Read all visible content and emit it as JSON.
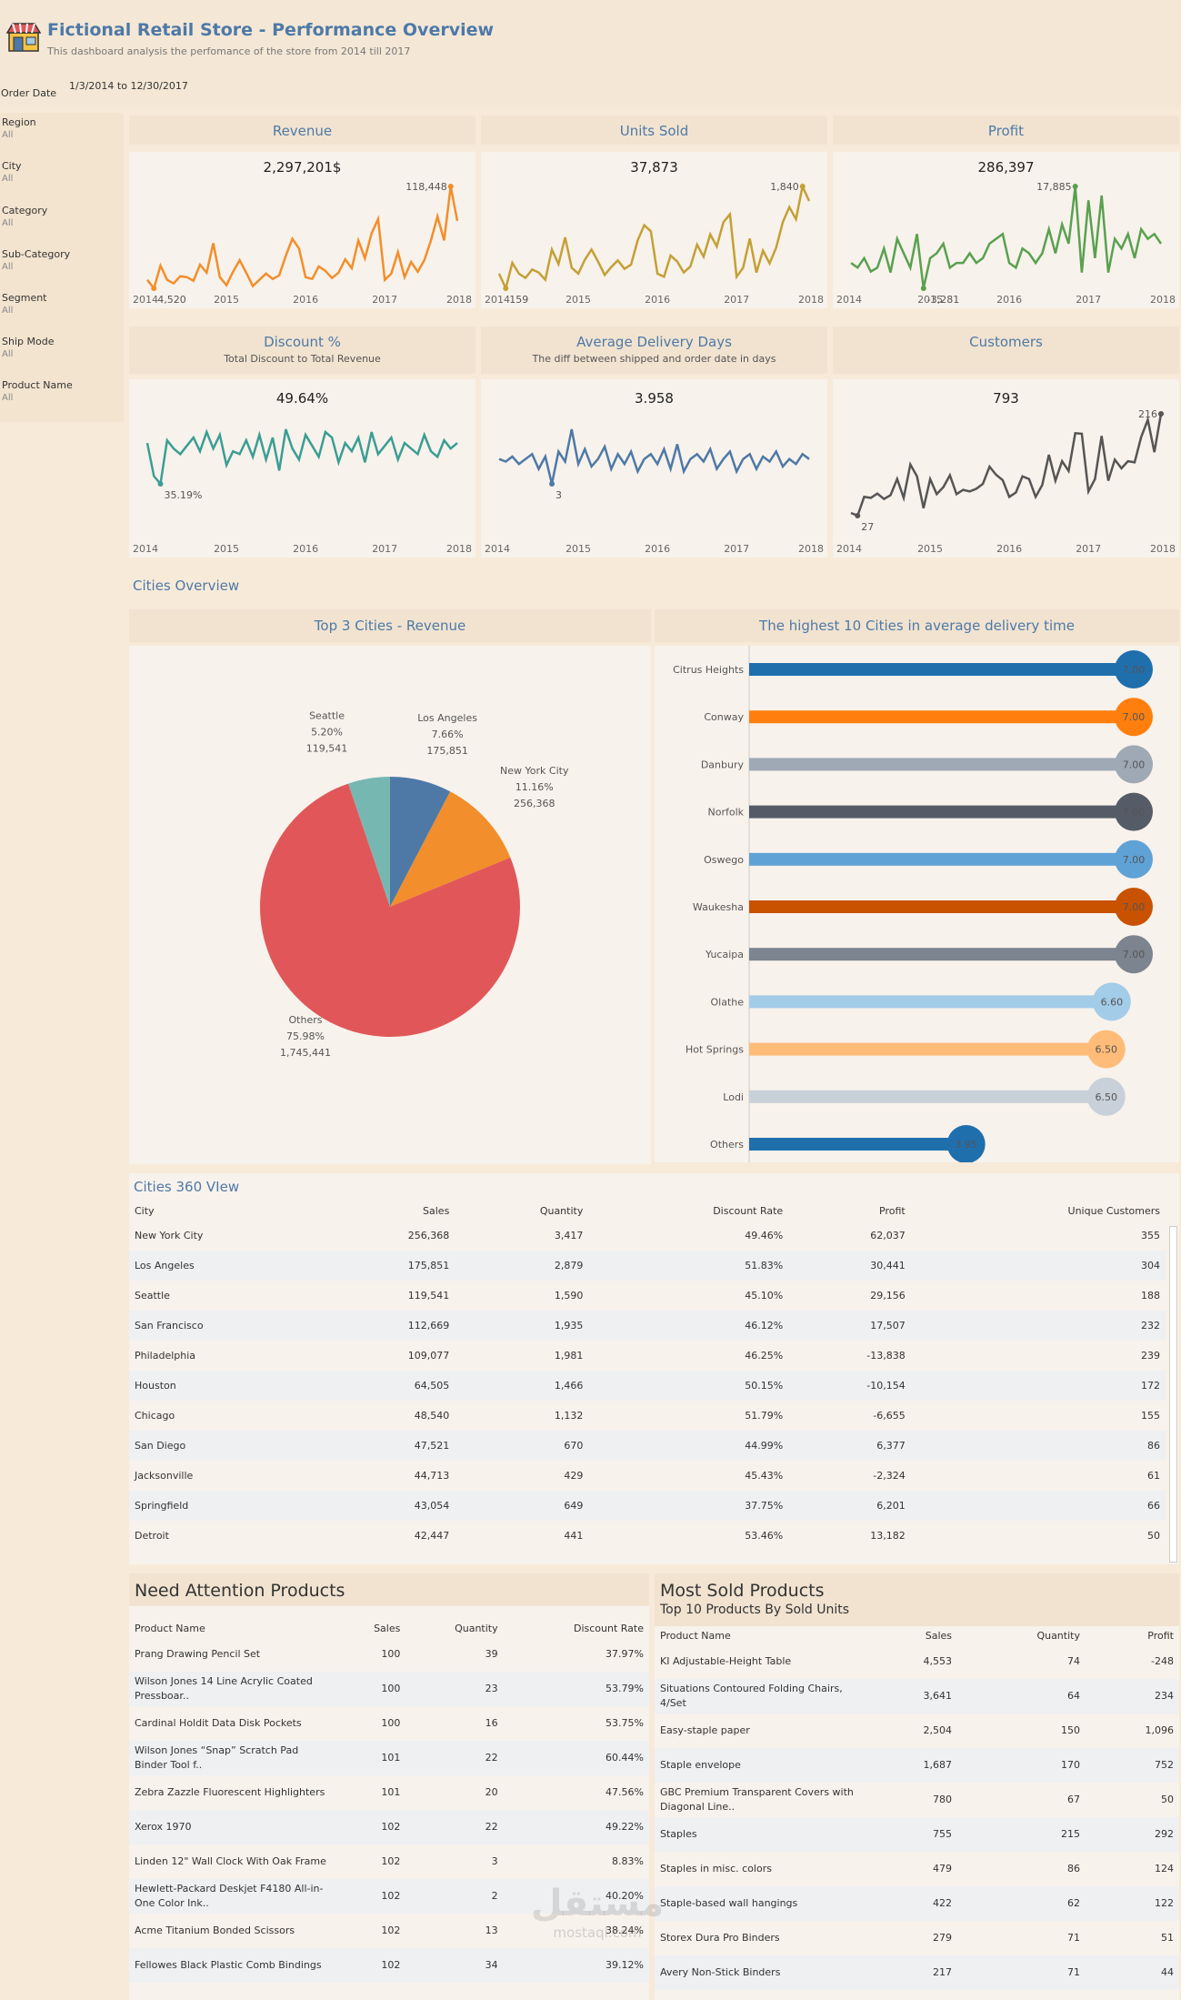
{
  "header": {
    "title": "Fictional Retail Store - Performance Overview",
    "subtitle": "This dashboard analysis the perfomance of the store from 2014 till 2017",
    "order_date_label": "Order Date",
    "order_date_value": "1/3/2014 to 12/30/2017"
  },
  "filters": [
    {
      "label": "Region",
      "value": "All"
    },
    {
      "label": "City",
      "value": "All"
    },
    {
      "label": "Category",
      "value": "All"
    },
    {
      "label": "Sub-Category",
      "value": "All"
    },
    {
      "label": "Segment",
      "value": "All"
    },
    {
      "label": "Ship Mode",
      "value": "All"
    },
    {
      "label": "Product Name",
      "value": "All"
    }
  ],
  "kpis": {
    "revenue": {
      "title": "Revenue",
      "value": "2,297,201$",
      "min_label": "4,520",
      "max_label": "118,448"
    },
    "units": {
      "title": "Units Sold",
      "value": "37,873",
      "min_label": "159",
      "max_label": "1,840"
    },
    "profit": {
      "title": "Profit",
      "value": "286,397",
      "min_label": "-3,281",
      "max_label": "17,885"
    },
    "discount": {
      "title": "Discount %",
      "subtitle": "Total Discount to Total Revenue",
      "value": "49.64%",
      "min_label": "35.19%"
    },
    "delivery": {
      "title": "Average Delivery Days",
      "subtitle": "The diff between shipped and order date in days",
      "value": "3.958",
      "min_label": "3"
    },
    "customers": {
      "title": "Customers",
      "value": "793",
      "min_label": "27",
      "max_label": "216"
    }
  },
  "years": [
    "2014",
    "2015",
    "2016",
    "2017",
    "2018"
  ],
  "colors": {
    "revenue": "#f28e2b",
    "units": "#c4a035",
    "profit": "#59a14f",
    "discount": "#3a9e94",
    "delivery": "#4e79a7",
    "customers": "#555555"
  },
  "chart_data": [
    {
      "type": "line",
      "title": "Revenue",
      "x_range": [
        "2014-01",
        "2017-12"
      ],
      "series": [
        {
          "values": [
            14000,
            4520,
            30000,
            14000,
            10000,
            18000,
            17000,
            13000,
            31000,
            22000,
            55000,
            17000,
            8000,
            23000,
            36000,
            22000,
            7000,
            14000,
            21000,
            15000,
            19000,
            41000,
            60000,
            49000,
            17000,
            15000,
            29000,
            24000,
            16000,
            22000,
            37000,
            27000,
            58000,
            38000,
            66000,
            82000,
            14000,
            21000,
            45000,
            17000,
            34000,
            23000,
            36000,
            58000,
            85000,
            58000,
            118448,
            80000
          ]
        }
      ]
    },
    {
      "type": "line",
      "title": "Units Sold",
      "x_range": [
        "2014-01",
        "2017-12"
      ],
      "series": [
        {
          "values": [
            400,
            159,
            580,
            400,
            330,
            470,
            420,
            300,
            800,
            560,
            1000,
            500,
            400,
            630,
            800,
            600,
            380,
            510,
            620,
            480,
            550,
            950,
            1200,
            1100,
            400,
            350,
            700,
            600,
            420,
            520,
            880,
            680,
            1050,
            850,
            1250,
            1380,
            350,
            500,
            980,
            420,
            780,
            570,
            830,
            1250,
            1500,
            1300,
            1840,
            1600
          ]
        }
      ]
    },
    {
      "type": "line",
      "title": "Profit",
      "x_range": [
        "2014-01",
        "2017-12"
      ],
      "series": [
        {
          "values": [
            2000,
            1000,
            3000,
            200,
            1000,
            5000,
            0,
            7000,
            4000,
            1000,
            8000,
            -3281,
            3000,
            4000,
            6000,
            1000,
            2000,
            2000,
            4000,
            2000,
            3000,
            6000,
            7000,
            8000,
            2000,
            1000,
            5000,
            4000,
            2000,
            4000,
            9000,
            4000,
            10000,
            6000,
            17885,
            0,
            15000,
            3000,
            16000,
            0,
            7000,
            5000,
            8000,
            3000,
            9000,
            7000,
            8000,
            6000
          ]
        }
      ]
    },
    {
      "type": "line",
      "title": "Discount %",
      "x_range": [
        "2014-01",
        "2017-12"
      ],
      "series": [
        {
          "values": [
            50,
            38,
            35.19,
            51,
            48,
            46,
            49,
            52,
            47,
            54,
            48,
            53,
            42,
            47,
            46,
            51,
            45,
            53,
            44,
            52,
            40,
            55,
            48,
            44,
            53,
            49,
            45,
            54,
            52,
            43,
            50,
            47,
            52,
            43,
            54,
            46,
            49,
            52,
            44,
            50,
            48,
            46,
            53,
            47,
            45,
            51,
            48,
            50
          ]
        }
      ]
    },
    {
      "type": "line",
      "title": "Average Delivery Days",
      "x_range": [
        "2014-01",
        "2017-12"
      ],
      "series": [
        {
          "values": [
            4.0,
            3.9,
            4.1,
            3.8,
            4.0,
            4.2,
            3.6,
            4.1,
            3.0,
            4.3,
            3.9,
            5.2,
            3.8,
            4.4,
            3.7,
            4.0,
            4.5,
            3.6,
            4.2,
            3.8,
            4.3,
            3.5,
            4.0,
            4.2,
            3.8,
            4.4,
            3.6,
            4.6,
            3.5,
            4.0,
            4.2,
            3.9,
            4.4,
            3.6,
            4.0,
            4.3,
            3.5,
            4.0,
            4.2,
            3.6,
            4.1,
            3.9,
            4.3,
            3.7,
            4.0,
            3.8,
            4.2,
            4.0
          ]
        }
      ]
    },
    {
      "type": "line",
      "title": "Customers",
      "x_range": [
        "2014-01",
        "2017-12"
      ],
      "series": [
        {
          "values": [
            32,
            27,
            62,
            60,
            68,
            58,
            65,
            95,
            60,
            122,
            100,
            41,
            95,
            67,
            80,
            102,
            67,
            75,
            72,
            77,
            86,
            118,
            103,
            93,
            62,
            70,
            100,
            95,
            62,
            84,
            140,
            92,
            128,
            110,
            180,
            179,
            72,
            95,
            175,
            92,
            131,
            115,
            128,
            126,
            173,
            205,
            145,
            216
          ]
        }
      ]
    },
    {
      "type": "pie",
      "title": "Top 3 Cities - Revenue",
      "slices": [
        {
          "label": "Los Angeles",
          "pct": "7.66%",
          "value": 175851,
          "value_label": "175,851",
          "color": "#4e79a7"
        },
        {
          "label": "New York City",
          "pct": "11.16%",
          "value": 256368,
          "value_label": "256,368",
          "color": "#f28e2b"
        },
        {
          "label": "Others",
          "pct": "75.98%",
          "value": 1745441,
          "value_label": "1,745,441",
          "color": "#e15759"
        },
        {
          "label": "Seattle",
          "pct": "5.20%",
          "value": 119541,
          "value_label": "119,541",
          "color": "#76b7b2"
        }
      ]
    },
    {
      "type": "bar",
      "title": "The highest 10 Cities in average delivery time",
      "categories": [
        "Citrus Heights",
        "Conway",
        "Danbury",
        "Norfolk",
        "Oswego",
        "Waukesha",
        "Yucaipa",
        "Olathe",
        "Hot Springs",
        "Lodi",
        "Others"
      ],
      "values": [
        7.0,
        7.0,
        7.0,
        7.0,
        7.0,
        7.0,
        7.0,
        6.6,
        6.5,
        6.5,
        3.95
      ],
      "value_labels": [
        "7.00",
        "7.00",
        "7.00",
        "7.00",
        "7.00",
        "7.00",
        "7.00",
        "6.60",
        "6.50",
        "6.50",
        "3.95"
      ],
      "colors": [
        "#1f6fad",
        "#ff7f0e",
        "#9ea9b5",
        "#555c68",
        "#5fa2d6",
        "#c85200",
        "#7b848f",
        "#a3cce9",
        "#ffbc79",
        "#c8d0d9",
        "#1f6fad"
      ],
      "xlim": [
        0,
        7.0
      ]
    }
  ],
  "cities_overview_title": "Cities Overview",
  "cities360": {
    "title": "Cities 360 VIew",
    "columns": [
      "City",
      "Sales",
      "Quantity",
      "Discount Rate",
      "Profit",
      "Unique Customers"
    ],
    "rows": [
      [
        "New York City",
        "256,368",
        "3,417",
        "49.46%",
        "62,037",
        "355"
      ],
      [
        "Los Angeles",
        "175,851",
        "2,879",
        "51.83%",
        "30,441",
        "304"
      ],
      [
        "Seattle",
        "119,541",
        "1,590",
        "45.10%",
        "29,156",
        "188"
      ],
      [
        "San Francisco",
        "112,669",
        "1,935",
        "46.12%",
        "17,507",
        "232"
      ],
      [
        "Philadelphia",
        "109,077",
        "1,981",
        "46.25%",
        "-13,838",
        "239"
      ],
      [
        "Houston",
        "64,505",
        "1,466",
        "50.15%",
        "-10,154",
        "172"
      ],
      [
        "Chicago",
        "48,540",
        "1,132",
        "51.79%",
        "-6,655",
        "155"
      ],
      [
        "San Diego",
        "47,521",
        "670",
        "44.99%",
        "6,377",
        "86"
      ],
      [
        "Jacksonville",
        "44,713",
        "429",
        "45.43%",
        "-2,324",
        "61"
      ],
      [
        "Springfield",
        "43,054",
        "649",
        "37.75%",
        "6,201",
        "66"
      ],
      [
        "Detroit",
        "42,447",
        "441",
        "53.46%",
        "13,182",
        "50"
      ]
    ]
  },
  "attention": {
    "title": "Need Attention Products",
    "columns": [
      "Product Name",
      "Sales",
      "Quantity",
      "Discount Rate"
    ],
    "rows": [
      [
        "Prang Drawing Pencil Set",
        "100",
        "39",
        "37.97%"
      ],
      [
        "Wilson Jones 14 Line Acrylic Coated Pressboar..",
        "100",
        "23",
        "53.79%"
      ],
      [
        "Cardinal Holdit Data Disk Pockets",
        "100",
        "16",
        "53.75%"
      ],
      [
        "Wilson Jones “Snap” Scratch Pad Binder Tool f..",
        "101",
        "22",
        "60.44%"
      ],
      [
        "Zebra Zazzle Fluorescent Highlighters",
        "101",
        "20",
        "47.56%"
      ],
      [
        "Xerox 1970",
        "102",
        "22",
        "49.22%"
      ],
      [
        "Linden 12\" Wall Clock With Oak Frame",
        "102",
        "3",
        "8.83%"
      ],
      [
        "Hewlett-Packard Deskjet F4180 All-in-One Color Ink..",
        "102",
        "2",
        "40.20%"
      ],
      [
        "Acme Titanium Bonded Scissors",
        "102",
        "13",
        "38.24%"
      ],
      [
        "Fellowes Black Plastic Comb Bindings",
        "102",
        "34",
        "39.12%"
      ]
    ]
  },
  "most_sold": {
    "title": "Most Sold Products",
    "subtitle": "Top 10 Products By Sold Units",
    "columns": [
      "Product Name",
      "Sales",
      "Quantity",
      "Profit"
    ],
    "rows": [
      [
        "KI Adjustable-Height Table",
        "4,553",
        "74",
        "-248"
      ],
      [
        "Situations Contoured Folding Chairs, 4/Set",
        "3,641",
        "64",
        "234"
      ],
      [
        "Easy-staple paper",
        "2,504",
        "150",
        "1,096"
      ],
      [
        "Staple envelope",
        "1,687",
        "170",
        "752"
      ],
      [
        "GBC Premium Transparent Covers with Diagonal Line..",
        "780",
        "67",
        "50"
      ],
      [
        "Staples",
        "755",
        "215",
        "292"
      ],
      [
        "Staples in misc. colors",
        "479",
        "86",
        "124"
      ],
      [
        "Staple-based wall hangings",
        "422",
        "62",
        "122"
      ],
      [
        "Storex Dura Pro Binders",
        "279",
        "71",
        "51"
      ],
      [
        "Avery Non-Stick Binders",
        "217",
        "71",
        "44"
      ]
    ]
  },
  "watermark": {
    "arabic": "مستقل",
    "latin": "mostaql.com"
  }
}
